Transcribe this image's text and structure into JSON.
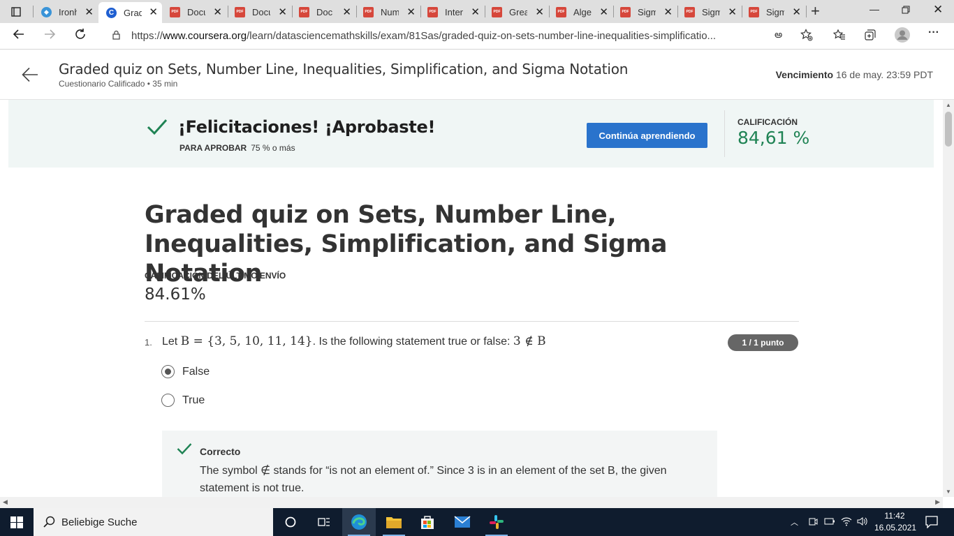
{
  "browser": {
    "tabs": [
      {
        "label": "Ironh",
        "icon": "shield-icon"
      },
      {
        "label": "Grad",
        "icon": "coursera-icon"
      },
      {
        "label": "Docu",
        "icon": "pdf-icon"
      },
      {
        "label": "Docu",
        "icon": "pdf-icon"
      },
      {
        "label": "Doc",
        "icon": "pdf-icon"
      },
      {
        "label": "Num",
        "icon": "pdf-icon"
      },
      {
        "label": "Inter",
        "icon": "pdf-icon"
      },
      {
        "label": "Grea",
        "icon": "pdf-icon"
      },
      {
        "label": "Algel",
        "icon": "pdf-icon"
      },
      {
        "label": "Sigm",
        "icon": "pdf-icon"
      },
      {
        "label": "Sigm",
        "icon": "pdf-icon"
      },
      {
        "label": "Sigm",
        "icon": "pdf-icon"
      }
    ],
    "pdf_badge": "PDF",
    "url_prefix": "https://",
    "url_host": "www.coursera.org",
    "url_path": "/learn/datasciencemathskills/exam/81Sas/graded-quiz-on-sets-number-line-inequalities-simplificatio..."
  },
  "header": {
    "title": "Graded quiz on Sets, Number Line, Inequalities, Simplification, and Sigma Notation",
    "subtitle": "Cuestionario Calificado • 35 min",
    "due_label": "Vencimiento",
    "due_value": "16 de may. 23:59 PDT"
  },
  "banner": {
    "title": "¡Felicitaciones! ¡Aprobaste!",
    "pass_label": "PARA APROBAR",
    "pass_value": "75 % o más",
    "button_label": "Continúa aprendiendo",
    "grade_label": "CALIFICACIÓN",
    "grade_value": "84,61 %"
  },
  "quiz": {
    "title": "Graded quiz on Sets, Number Line, Inequalities, Simplification, and Sigma Notation",
    "last_label": "CALIFICACIÓN DEL ÚLTIMO ENVÍO",
    "last_value": "84.61%",
    "question": {
      "number": "1.",
      "text_before": "Let ",
      "set_expr": "B = {3, 5, 10, 11, 14}",
      "text_after": ". Is the following statement true or false: ",
      "statement": "3 ∉ B",
      "points": "1 / 1 punto",
      "options": [
        {
          "label": "False",
          "selected": true
        },
        {
          "label": "True",
          "selected": false
        }
      ],
      "feedback": {
        "title": "Correcto",
        "text": "The symbol ∉ stands for “is not an element of.” Since 3 is in an element of the set B, the given statement is not true."
      }
    }
  },
  "taskbar": {
    "search_placeholder": "Beliebige Suche",
    "time": "11:42",
    "date": "16.05.2021"
  },
  "colors": {
    "accent": "#2a73cc",
    "success": "#1f8354",
    "banner_bg": "#f0f6f5",
    "taskbar_bg": "#0f1c2e"
  }
}
